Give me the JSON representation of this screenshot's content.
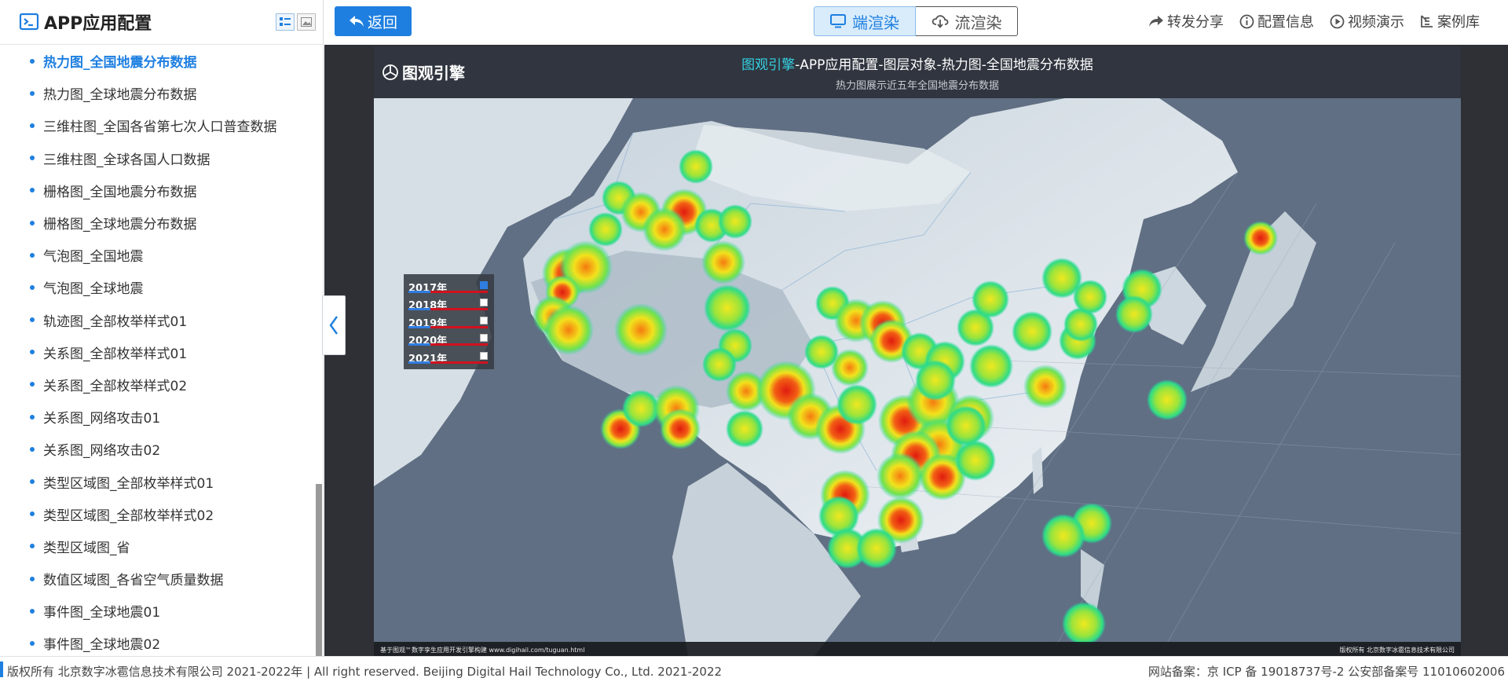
{
  "sidebar": {
    "title": "APP应用配置",
    "items": [
      {
        "label": "热力图_全国地震分布数据",
        "active": true
      },
      {
        "label": "热力图_全球地震分布数据"
      },
      {
        "label": "三维柱图_全国各省第七次人口普查数据"
      },
      {
        "label": "三维柱图_全球各国人口数据"
      },
      {
        "label": "栅格图_全国地震分布数据"
      },
      {
        "label": "栅格图_全球地震分布数据"
      },
      {
        "label": "气泡图_全国地震"
      },
      {
        "label": "气泡图_全球地震"
      },
      {
        "label": "轨迹图_全部枚举样式01"
      },
      {
        "label": "关系图_全部枚举样式01"
      },
      {
        "label": "关系图_全部枚举样式02"
      },
      {
        "label": "关系图_网络攻击01"
      },
      {
        "label": "关系图_网络攻击02"
      },
      {
        "label": "类型区域图_全部枚举样式01"
      },
      {
        "label": "类型区域图_全部枚举样式02"
      },
      {
        "label": "类型区域图_省"
      },
      {
        "label": "数值区域图_各省空气质量数据"
      },
      {
        "label": "事件图_全球地震01"
      },
      {
        "label": "事件图_全球地震02"
      }
    ]
  },
  "toolbar": {
    "back_label": "返回",
    "render_client_label": "端渲染",
    "render_stream_label": "流渲染",
    "share_label": "转发分享",
    "config_label": "配置信息",
    "video_label": "视频演示",
    "cases_label": "案例库"
  },
  "scene": {
    "brand": "图观引擎",
    "title_highlight": "图观引擎",
    "title_rest": "-APP应用配置-图层对象-热力图-全国地震分布数据",
    "subtitle": "热力图展示近五年全国地震分布数据",
    "footer_left": "基于图观™数字孪生应用开发引擎构建 www.digihail.com/tuguan.html",
    "footer_right": "版权所有 北京数字冰雹信息技术有限公司"
  },
  "legend": [
    {
      "year": "2017年",
      "checked": true
    },
    {
      "year": "2018年",
      "checked": false
    },
    {
      "year": "2019年",
      "checked": false
    },
    {
      "year": "2020年",
      "checked": false
    },
    {
      "year": "2021年",
      "checked": false
    }
  ],
  "status": {
    "left": "版权所有 北京数字冰雹信息技术有限公司 2021-2022年 | All right reserved. Beijing Digital Hail Technology Co., Ltd. 2021-2022",
    "right": "网站备案：京 ICP 备 19018737号-2 公安部备案号 11010602006"
  },
  "colors": {
    "accent": "#1e7fe0",
    "title_highlight": "#34d1e3",
    "heat_low": "#1ed8a0",
    "heat_mid": "#f2e21c",
    "heat_high": "#e01b10"
  }
}
